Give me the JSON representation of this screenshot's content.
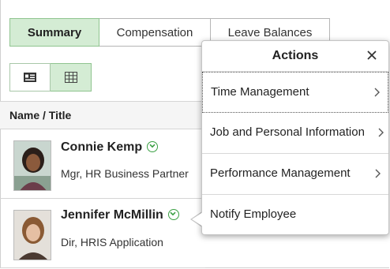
{
  "tabs": [
    {
      "label": "Summary",
      "active": true
    },
    {
      "label": "Compensation",
      "active": false
    },
    {
      "label": "Leave Balances",
      "active": false
    }
  ],
  "view_toggle": {
    "list_icon": "list-card-icon",
    "grid_icon": "grid-icon",
    "active": "grid"
  },
  "table": {
    "header": "Name / Title",
    "rows": [
      {
        "name": "Connie Kemp",
        "title": "Mgr, HR Business Partner"
      },
      {
        "name": "Jennifer McMillin",
        "title": "Dir, HRIS Application"
      }
    ]
  },
  "actions_popup": {
    "title": "Actions",
    "items": [
      {
        "label": "Time Management",
        "has_submenu": true
      },
      {
        "label": "Job and Personal Information",
        "has_submenu": true
      },
      {
        "label": "Performance Management",
        "has_submenu": true
      },
      {
        "label": "Notify Employee",
        "has_submenu": false
      }
    ]
  },
  "colors": {
    "active_tab_bg": "#d4ecd4",
    "active_tab_border": "#8fc48f",
    "chevron_green": "#3aa043"
  }
}
